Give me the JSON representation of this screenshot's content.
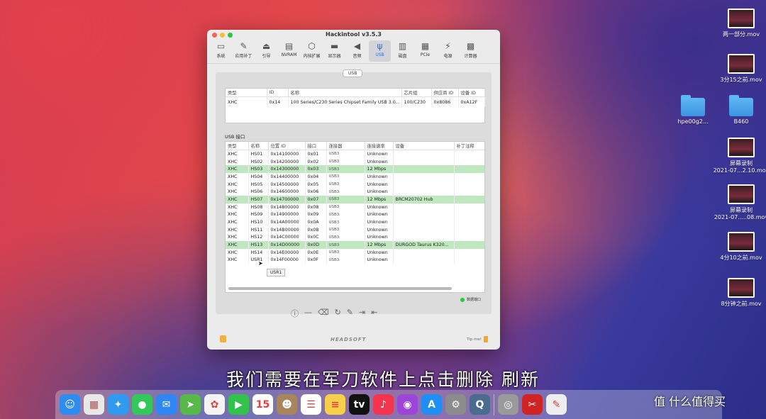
{
  "window": {
    "title": "Hackintool v3.5.3",
    "toolbar": [
      {
        "label": "系统",
        "icon": "computer-icon"
      },
      {
        "label": "应用补丁",
        "icon": "pencil-icon"
      },
      {
        "label": "引导",
        "icon": "boot-icon"
      },
      {
        "label": "NVRAM",
        "icon": "chip-icon"
      },
      {
        "label": "内核扩展",
        "icon": "box-icon"
      },
      {
        "label": "显示器",
        "icon": "monitor-icon"
      },
      {
        "label": "音频",
        "icon": "speaker-icon"
      },
      {
        "label": "USB",
        "icon": "usb-icon"
      },
      {
        "label": "磁盘",
        "icon": "disk-icon"
      },
      {
        "label": "PCIe",
        "icon": "pcie-icon"
      },
      {
        "label": "电源",
        "icon": "power-icon"
      },
      {
        "label": "计算器",
        "icon": "calculator-icon"
      }
    ],
    "active_tab": "USB",
    "segment_label": "USB",
    "controllers": {
      "headers": [
        "类型",
        "ID",
        "名称",
        "芯片组",
        "供应商 ID",
        "设备 ID"
      ],
      "rows": [
        [
          "XHC",
          "0x14",
          "100 Series/C230 Series Chipset Family USB 3.0...",
          "100/C230",
          "0x8086",
          "0xA12F"
        ]
      ]
    },
    "ports_label": "USB 接口",
    "ports": {
      "headers": [
        "类型",
        "名称",
        "位置 ID",
        "接口",
        "连接器",
        "连接速率",
        "设备",
        "补丁注释"
      ],
      "rows": [
        {
          "type": "XHC",
          "name": "HS01",
          "loc": "0x14100000",
          "port": "0x01",
          "conn": "USB3",
          "speed": "Unknown",
          "device": "",
          "hl": false
        },
        {
          "type": "XHC",
          "name": "HS02",
          "loc": "0x14200000",
          "port": "0x02",
          "conn": "USB3",
          "speed": "Unknown",
          "device": "",
          "hl": false
        },
        {
          "type": "XHC",
          "name": "HS03",
          "loc": "0x14300000",
          "port": "0x03",
          "conn": "USB3",
          "speed": "12 Mbps",
          "device": "",
          "hl": true
        },
        {
          "type": "XHC",
          "name": "HS04",
          "loc": "0x14400000",
          "port": "0x04",
          "conn": "USB3",
          "speed": "Unknown",
          "device": "",
          "hl": false
        },
        {
          "type": "XHC",
          "name": "HS05",
          "loc": "0x14500000",
          "port": "0x05",
          "conn": "USB3",
          "speed": "Unknown",
          "device": "",
          "hl": false
        },
        {
          "type": "XHC",
          "name": "HS06",
          "loc": "0x14600000",
          "port": "0x06",
          "conn": "USB3",
          "speed": "Unknown",
          "device": "",
          "hl": false
        },
        {
          "type": "XHC",
          "name": "HS07",
          "loc": "0x14700000",
          "port": "0x07",
          "conn": "USB3",
          "speed": "12 Mbps",
          "device": "BRCM20702 Hub",
          "hl": true
        },
        {
          "type": "XHC",
          "name": "HS08",
          "loc": "0x14800000",
          "port": "0x08",
          "conn": "USB3",
          "speed": "Unknown",
          "device": "",
          "hl": false
        },
        {
          "type": "XHC",
          "name": "HS09",
          "loc": "0x14900000",
          "port": "0x09",
          "conn": "USB3",
          "speed": "Unknown",
          "device": "",
          "hl": false
        },
        {
          "type": "XHC",
          "name": "HS10",
          "loc": "0x14A00000",
          "port": "0x0A",
          "conn": "USB3",
          "speed": "Unknown",
          "device": "",
          "hl": false
        },
        {
          "type": "XHC",
          "name": "HS11",
          "loc": "0x14B00000",
          "port": "0x0B",
          "conn": "USB3",
          "speed": "Unknown",
          "device": "",
          "hl": false
        },
        {
          "type": "XHC",
          "name": "HS12",
          "loc": "0x14C00000",
          "port": "0x0C",
          "conn": "USB3",
          "speed": "Unknown",
          "device": "",
          "hl": false
        },
        {
          "type": "XHC",
          "name": "HS13",
          "loc": "0x14D00000",
          "port": "0x0D",
          "conn": "USB3",
          "speed": "12 Mbps",
          "device": "DURGOD Taurus K320...",
          "hl": true
        },
        {
          "type": "XHC",
          "name": "HS14",
          "loc": "0x14E00000",
          "port": "0x0E",
          "conn": "USB3",
          "speed": "Unknown",
          "device": "",
          "hl": false
        },
        {
          "type": "XHC",
          "name": "USR1",
          "loc": "0x14F00000",
          "port": "0x0F",
          "conn": "USB3",
          "speed": "Unknown",
          "device": "",
          "hl": false
        }
      ]
    },
    "tooltip": "USR1",
    "legend_label": "数据端口",
    "brand": "HEADSOFT",
    "tipme": "Tip me!"
  },
  "desktop": [
    {
      "label": "两一部分.mov",
      "kind": "video"
    },
    {
      "label": "3分15之前.mov",
      "kind": "video"
    },
    {
      "label": "hpe00g2...",
      "kind": "folder"
    },
    {
      "label": "B460",
      "kind": "folder"
    },
    {
      "label": "屏幕录制\n2021-07...2.10.mov",
      "kind": "video"
    },
    {
      "label": "屏幕录制\n2021-07.....08.mov",
      "kind": "video"
    },
    {
      "label": "4分10之前.mov",
      "kind": "video"
    },
    {
      "label": "8分钟之前.mov",
      "kind": "video"
    }
  ],
  "subtitle": "我们需要在军刀软件上点击删除 刷新",
  "dock": {
    "items": [
      {
        "name": "finder-icon",
        "glyph": "☺",
        "color": "#2d8cf0"
      },
      {
        "name": "launchpad-icon",
        "glyph": "▦",
        "color": "#e8e8e8"
      },
      {
        "name": "safari-icon",
        "glyph": "✦",
        "color": "#2f9bf0"
      },
      {
        "name": "messages-icon",
        "glyph": "●",
        "color": "#34c759"
      },
      {
        "name": "mail-icon",
        "glyph": "✉",
        "color": "#2f86f5"
      },
      {
        "name": "maps-icon",
        "glyph": "➤",
        "color": "#58b848"
      },
      {
        "name": "photos-icon",
        "glyph": "✿",
        "color": "#f4f4f4"
      },
      {
        "name": "facetime-icon",
        "glyph": "▶",
        "color": "#30c24a"
      },
      {
        "name": "calendar-icon",
        "glyph": "15",
        "color": "#ffffff"
      },
      {
        "name": "contacts-icon",
        "glyph": "☻",
        "color": "#a8855c"
      },
      {
        "name": "reminders-icon",
        "glyph": "☰",
        "color": "#ffffff"
      },
      {
        "name": "notes-icon",
        "glyph": "≡",
        "color": "#f7d04a"
      },
      {
        "name": "tv-icon",
        "glyph": "tv",
        "color": "#111111"
      },
      {
        "name": "music-icon",
        "glyph": "♪",
        "color": "#f5344d"
      },
      {
        "name": "podcasts-icon",
        "glyph": "◉",
        "color": "#9b46d8"
      },
      {
        "name": "app-store-icon",
        "glyph": "A",
        "color": "#1f8ef5"
      },
      {
        "name": "system-preferences-icon",
        "glyph": "⚙",
        "color": "#8c8c8c"
      },
      {
        "name": "quicktime-icon",
        "glyph": "Q",
        "color": "#4b6c8e"
      },
      {
        "name": "disk-utility-icon",
        "glyph": "◎",
        "color": "#9a9a9a"
      },
      {
        "name": "hackintool-icon",
        "glyph": "✂",
        "color": "#d02424"
      },
      {
        "name": "text-edit-icon",
        "glyph": "✎",
        "color": "#eeeeee"
      }
    ]
  },
  "watermark": "值 什么值得买"
}
